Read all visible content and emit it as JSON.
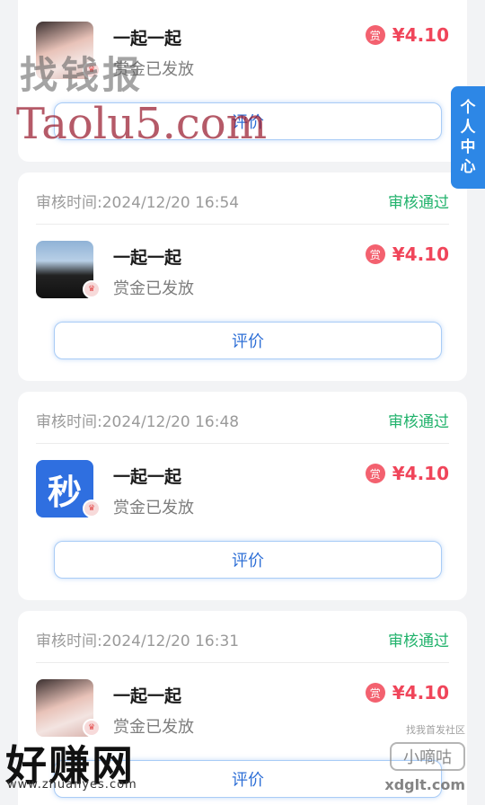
{
  "side_tab": [
    "个",
    "人",
    "中",
    "心"
  ],
  "cards": [
    {
      "review_time": "",
      "status": "",
      "avatar_type": "photo-a",
      "avatar_text": "",
      "title": "一起一起",
      "subtitle": "赏金已发放",
      "reward_tag": "赏",
      "reward": "¥4.10",
      "button": "评价"
    },
    {
      "review_time": "审核时间:2024/12/20 16:54",
      "status": "审核通过",
      "avatar_type": "photo-b",
      "avatar_text": "",
      "title": "一起一起",
      "subtitle": "赏金已发放",
      "reward_tag": "赏",
      "reward": "¥4.10",
      "button": "评价"
    },
    {
      "review_time": "审核时间:2024/12/20 16:48",
      "status": "审核通过",
      "avatar_type": "app",
      "avatar_text": "秒",
      "title": "一起一起",
      "subtitle": "赏金已发放",
      "reward_tag": "赏",
      "reward": "¥4.10",
      "button": "评价"
    },
    {
      "review_time": "审核时间:2024/12/20 16:31",
      "status": "审核通过",
      "avatar_type": "photo-a",
      "avatar_text": "",
      "title": "一起一起",
      "subtitle": "赏金已发放",
      "reward_tag": "赏",
      "reward": "¥4.10",
      "button": "评价"
    }
  ],
  "watermarks": {
    "top_cn": "找钱报",
    "top_en": "Taolu5.com",
    "bottom_cn": "好赚网",
    "bottom_url": "www.zhuanyes.com",
    "community": "找我首发社区",
    "brand": "小嘀咕",
    "brand_url": "xdglt.com"
  },
  "colors": {
    "accent_blue": "#2d87e6",
    "status_green": "#20b26b",
    "reward_red": "#f0455a"
  }
}
